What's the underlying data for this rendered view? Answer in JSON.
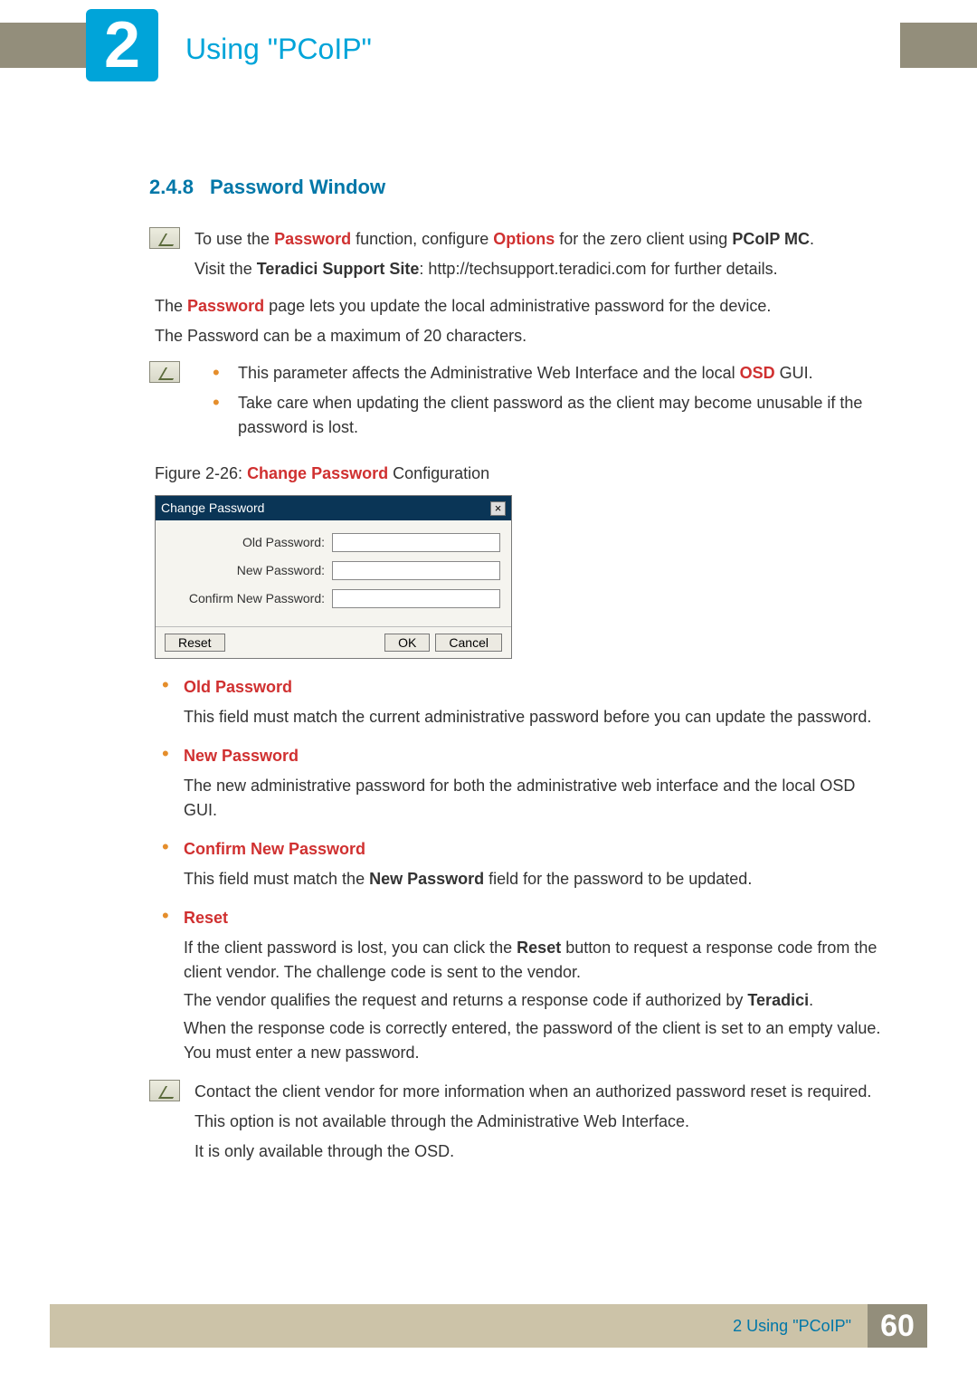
{
  "header": {
    "chapter_number": "2",
    "chapter_title": "Using \"PCoIP\""
  },
  "section": {
    "number": "2.4.8",
    "title": "Password Window"
  },
  "note1": {
    "line1_pre": "To use the ",
    "line1_b1": "Password",
    "line1_mid": " function, configure ",
    "line1_b2": "Options",
    "line1_mid2": " for the zero client using ",
    "line1_b3": "PCoIP MC",
    "line1_post": ".",
    "line2_pre": "Visit the ",
    "line2_b": "Teradici Support Site",
    "line2_post": ": http://techsupport.teradici.com for further details."
  },
  "intro": {
    "p1_pre": "The ",
    "p1_b": "Password",
    "p1_post": " page lets you update the local administrative password for the device.",
    "p2": "The  Password can be a maximum of 20 characters."
  },
  "note2": {
    "b1_pre": "This parameter affects the Administrative Web Interface and the local ",
    "b1_b": "OSD",
    "b1_post": " GUI.",
    "b2": "Take care when updating the client password as the client may become unusable if the password is lost."
  },
  "figure": {
    "label_pre": "Figure 2-26: ",
    "label_b": "Change Password",
    "label_post": " Configuration"
  },
  "dialog": {
    "title": "Change Password",
    "old_label": "Old Password:",
    "new_label": "New Password:",
    "confirm_label": "Confirm New Password:",
    "reset": "Reset",
    "ok": "OK",
    "cancel": "Cancel"
  },
  "definitions": [
    {
      "term": "Old Password",
      "paras": [
        "This field must match the current administrative password before you can update the password."
      ]
    },
    {
      "term": "New Password",
      "paras": [
        "The new administrative password for both the administrative web interface and the local OSD GUI."
      ]
    },
    {
      "term": "Confirm New Password",
      "paras_rich": {
        "pre": "This field must match the ",
        "b": "New Password",
        "post": " field for the password to be updated."
      }
    },
    {
      "term": "Reset",
      "paras_rich2": {
        "p1_pre": "If the client password is lost, you can click the ",
        "p1_b": "Reset",
        "p1_post": " button to request a response code from the client vendor. The challenge code is sent to the vendor.",
        "p2_pre": "The vendor qualifies the request and returns a response code if authorized by ",
        "p2_b": "Teradici",
        "p2_post": ".",
        "p3": "When the response code is correctly entered, the password of the client is set to an empty value. You must enter a new password."
      }
    }
  ],
  "note3": {
    "l1": "Contact the client vendor for more information when an authorized password reset is required.",
    "l2": "This option is not available through the Administrative Web Interface.",
    "l3": "It is only available through the OSD."
  },
  "footer": {
    "label": "2 Using \"PCoIP\"",
    "page": "60"
  }
}
